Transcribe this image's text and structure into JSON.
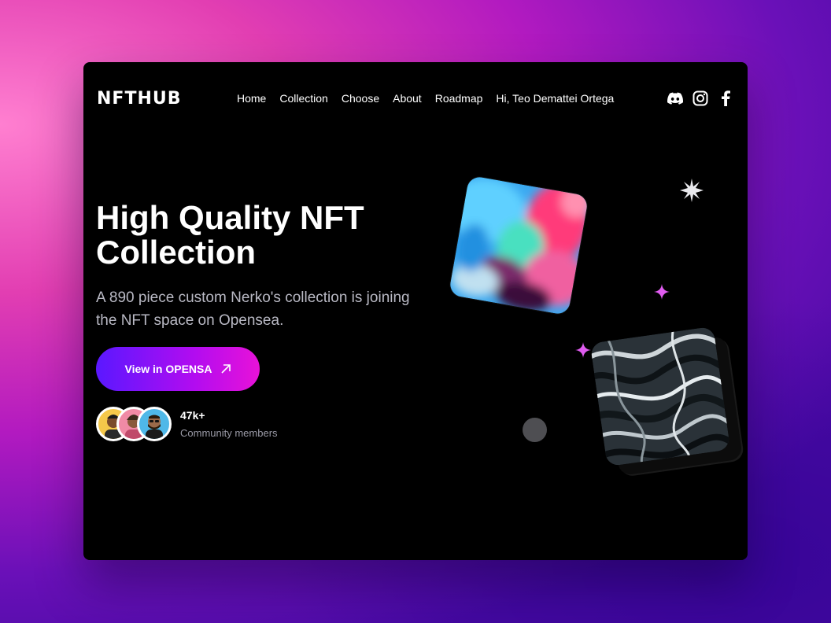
{
  "brand": {
    "logo": "NFTHUB"
  },
  "nav": {
    "items": [
      "Home",
      "Collection",
      "Choose",
      "About",
      "Roadmap",
      "Hi, Teo Demattei Ortega"
    ]
  },
  "socials": [
    "discord-icon",
    "instagram-icon",
    "facebook-icon"
  ],
  "hero": {
    "title_line1": "High Quality NFT",
    "title_line2": "Collection",
    "subtitle": "A 890 piece custom Nerko's collection is joining the NFT space on Opensea.",
    "cta_label": "View in OPENSA"
  },
  "community": {
    "count": "47k+",
    "label": "Community members"
  },
  "colors": {
    "accent_start": "#5a18ff",
    "accent_end": "#e812d8",
    "spark_pink": "#e05cf0",
    "background": "#000000"
  }
}
